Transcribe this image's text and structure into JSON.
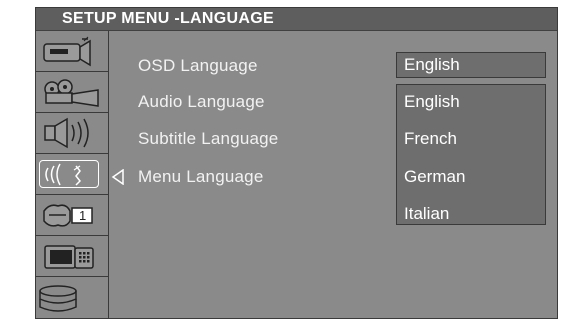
{
  "title": "SETUP MENU -LANGUAGE",
  "sidebar": {
    "items": [
      {
        "icon": "camera-icon",
        "selected": false
      },
      {
        "icon": "projector-icon",
        "selected": false
      },
      {
        "icon": "speaker-icon",
        "selected": false
      },
      {
        "icon": "language-icon",
        "selected": true
      },
      {
        "icon": "clock-icon",
        "selected": false
      },
      {
        "icon": "tv-icon",
        "selected": false
      },
      {
        "icon": "disc-stack-icon",
        "selected": false
      }
    ],
    "clock_digit": "1"
  },
  "settings": [
    {
      "label": "OSD Language"
    },
    {
      "label": "Audio Language"
    },
    {
      "label": "Subtitle Language"
    },
    {
      "label": "Menu Language"
    }
  ],
  "current_value": "English",
  "options": [
    "English",
    "French",
    "German",
    "Italian"
  ],
  "colors": {
    "panel": "#8a8a8a",
    "titlebar": "#5e5e5e",
    "option_box": "#6e6e6e",
    "border": "#3a3a3a",
    "text": "#ffffff"
  }
}
